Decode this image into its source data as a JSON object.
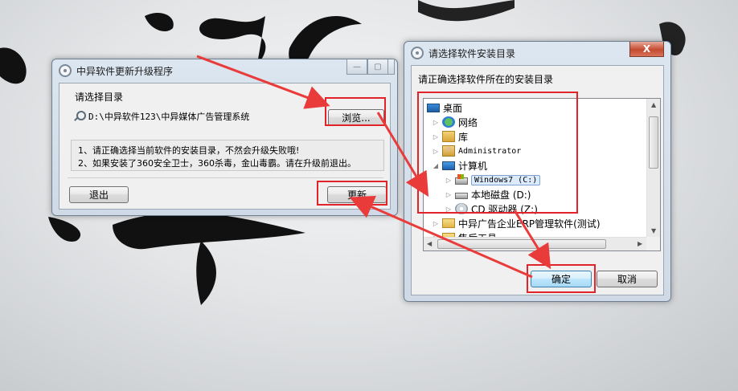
{
  "update_dialog": {
    "title": "中异软件更新升级程序",
    "group_label": "请选择目录",
    "path": "D:\\中异软件123\\中异媒体广告管理系统",
    "browse_button": "浏览...",
    "notes": [
      "1、请正确选择当前软件的安装目录，不然会升级失败哦!",
      "2、如果安装了360安全卫士，360杀毒，金山毒霸。请在升级前退出。"
    ],
    "exit_button": "退出",
    "update_button": "更新"
  },
  "folder_dialog": {
    "title": "请选择软件安装目录",
    "close_label": "X",
    "prompt": "请正确选择软件所在的安装目录",
    "tree": [
      {
        "label": "桌面",
        "icon": "desktop-icon",
        "expander": ""
      },
      {
        "label": "网络",
        "icon": "network-icon",
        "expander": "▷"
      },
      {
        "label": "库",
        "icon": "library-icon",
        "expander": "▷"
      },
      {
        "label": "Administrator",
        "icon": "user-folder-icon",
        "expander": "▷"
      },
      {
        "label": "计算机",
        "icon": "computer-icon",
        "expander": "◢"
      },
      {
        "label": "Windows7 (C:)",
        "icon": "system-drive-icon",
        "expander": "▷",
        "selected": true
      },
      {
        "label": "本地磁盘 (D:)",
        "icon": "drive-icon",
        "expander": "▷"
      },
      {
        "label": "CD 驱动器 (Z:)",
        "icon": "cd-drive-icon",
        "expander": "▷"
      },
      {
        "label": "中异广告企业ERP管理软件(测试)",
        "icon": "folder-icon",
        "expander": "▷"
      },
      {
        "label": "售后工具",
        "icon": "folder-icon",
        "expander": "▷"
      }
    ],
    "ok_button": "确定",
    "cancel_button": "取消"
  },
  "colors": {
    "highlight": "#e2232a",
    "arrow": "#ea3b3b"
  }
}
